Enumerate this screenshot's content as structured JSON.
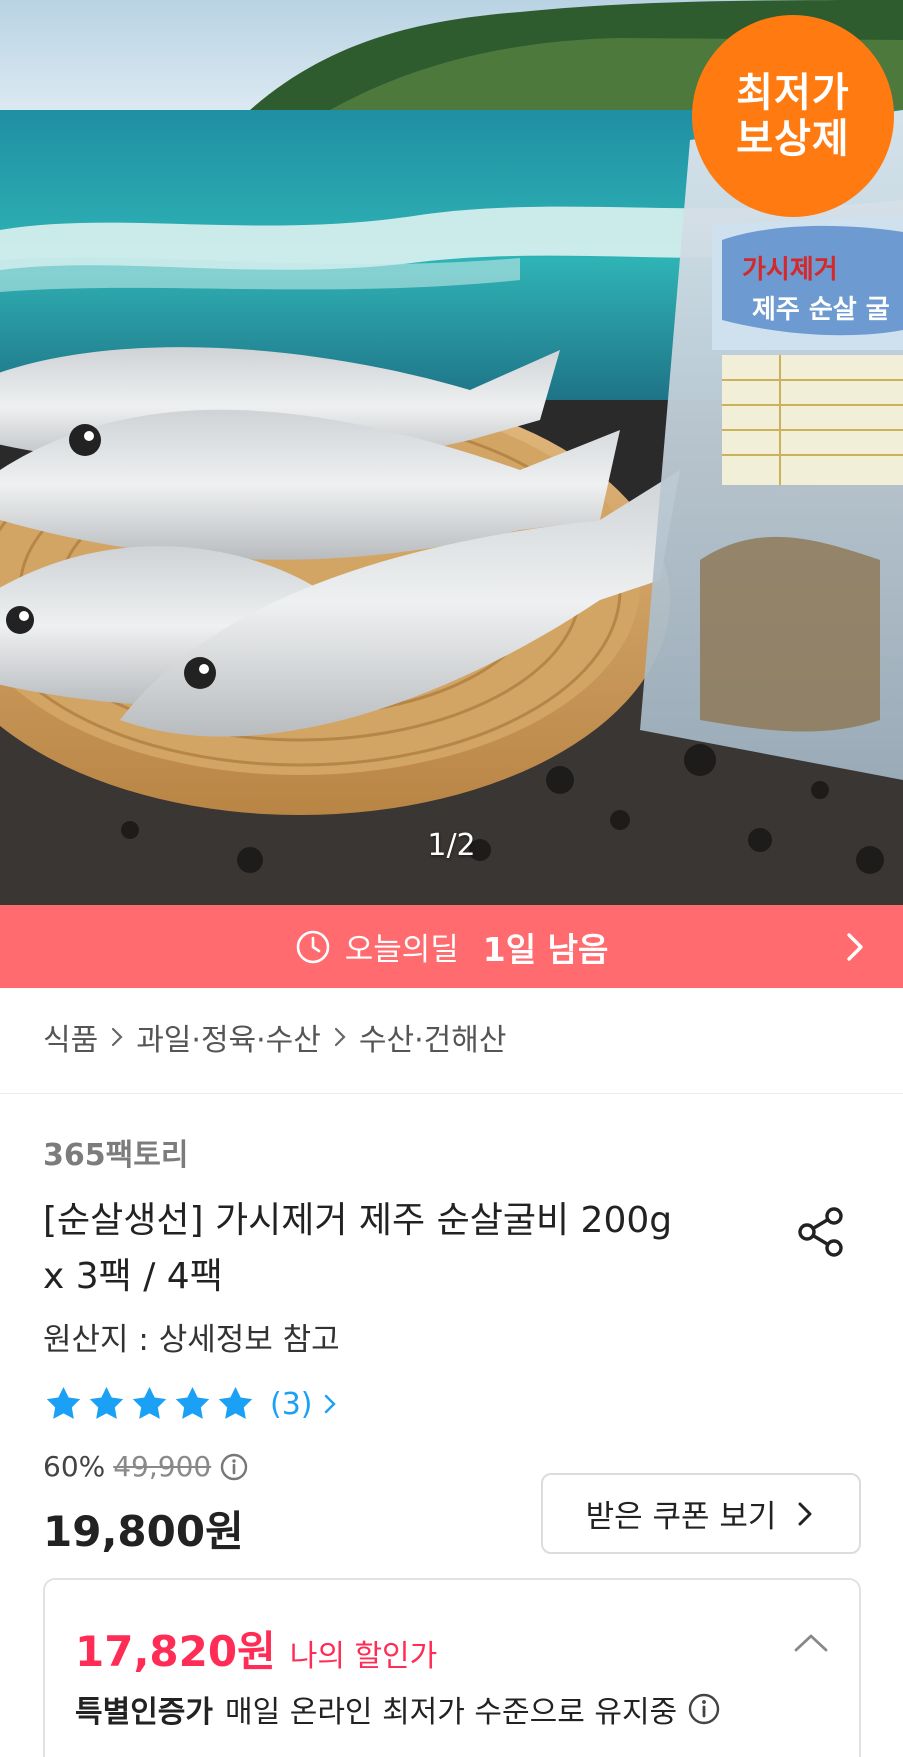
{
  "hero": {
    "badge_line1": "최저가",
    "badge_line2": "보상제",
    "image_counter": "1/2",
    "package_label_line1": "가시제거",
    "package_label_line2": "제주 순살 굴"
  },
  "deal_bar": {
    "label": "오늘의딜",
    "remaining": "1일 남음",
    "color": "#ff6b6e"
  },
  "breadcrumb": [
    "식품",
    "과일·정육·수산",
    "수산·건해산"
  ],
  "product": {
    "seller": "365팩토리",
    "title": "[순살생선] 가시제거 제주 순살굴비 200g x 3팩 / 4팩",
    "origin": "원산지 : 상세정보 참고",
    "rating_stars": 5,
    "review_count": "(3)",
    "discount_rate": "60%",
    "original_price": "49,900",
    "price": "19,800원",
    "coupon_button": "받은 쿠폰 보기"
  },
  "my_price": {
    "amount": "17,820원",
    "label": "나의 할인가",
    "certified_badge": "특별인증가",
    "certified_text": "매일 온라인 최저가 수준으로 유지중"
  },
  "colors": {
    "badge": "#ff7a10",
    "star": "#1aa0f5",
    "my_price": "#ff2c55"
  },
  "icons": [
    "clock-icon",
    "chevron-right-icon",
    "share-icon",
    "star-icon",
    "info-icon",
    "chevron-up-icon"
  ]
}
